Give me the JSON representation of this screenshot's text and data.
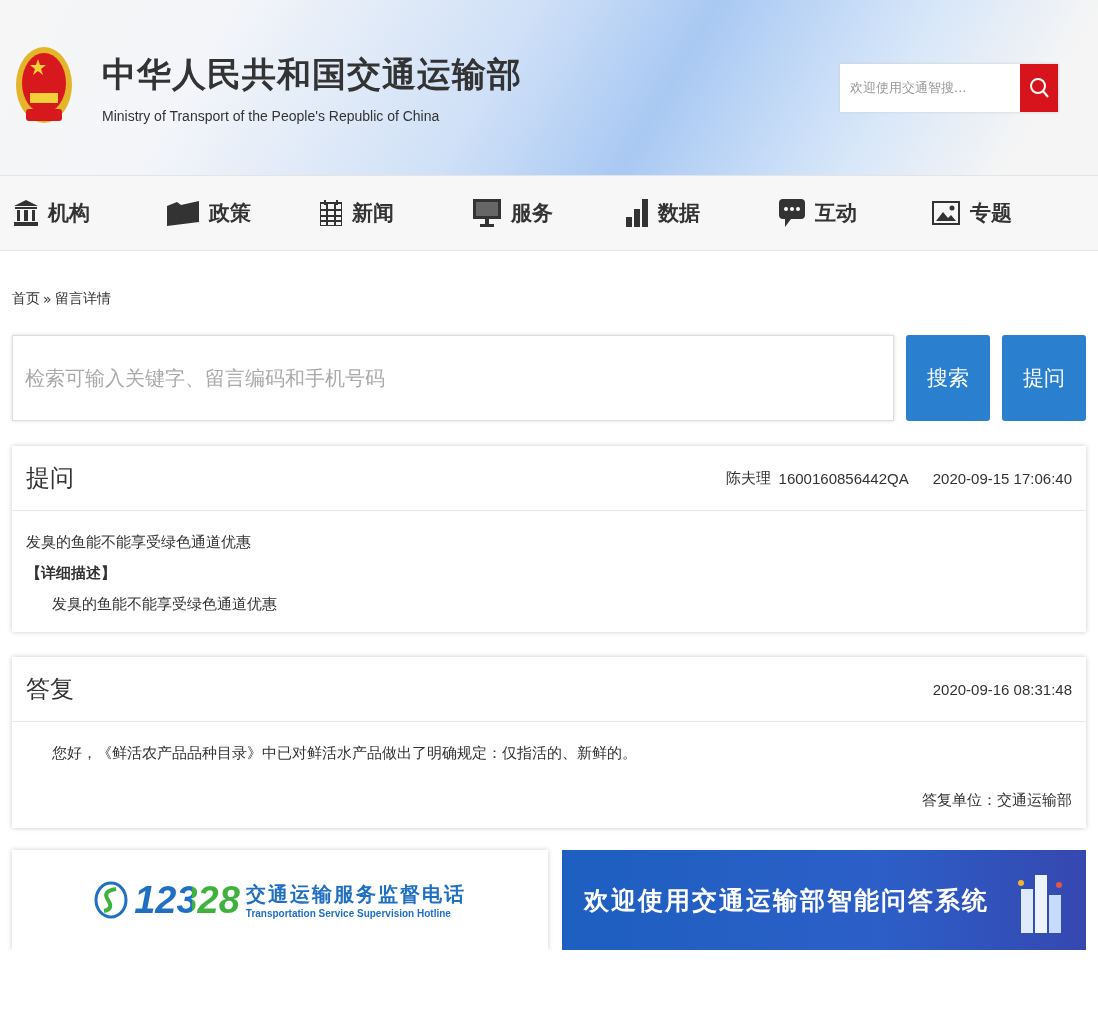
{
  "header": {
    "title": "中华人民共和国交通运输部",
    "subtitle": "Ministry of Transport of the People's Republic of China",
    "search": {
      "placeholder": "欢迎使用交通智搜..."
    }
  },
  "nav": [
    {
      "label": "机构"
    },
    {
      "label": "政策"
    },
    {
      "label": "新闻"
    },
    {
      "label": "服务"
    },
    {
      "label": "数据"
    },
    {
      "label": "互动"
    },
    {
      "label": "专题"
    }
  ],
  "breadcrumb": {
    "home": "首页",
    "separator": "»",
    "current": "留言详情"
  },
  "search": {
    "placeholder": "检索可输入关键字、留言编码和手机号码",
    "buttons": [
      "搜索",
      "提问"
    ]
  },
  "question": {
    "title": "提问",
    "author": "陈夫理",
    "code": "1600160856442QA",
    "time": "2020-09-15 17:06:40",
    "subject": "发臭的鱼能不能享受绿色通道优惠",
    "detail_label": "【详细描述】",
    "detail": "发臭的鱼能不能享受绿色通道优惠"
  },
  "answer": {
    "title": "答复",
    "time": "2020-09-16 08:31:48",
    "text": "您好，《鲜活农产品品种目录》中已对鲜活水产品做出了明确规定：仅指活的、新鲜的。",
    "unit": "答复单位：交通运输部"
  },
  "banners": {
    "hotline": {
      "number": "12328",
      "title": "交通运输服务监督电话",
      "subtitle": "Transportation Service Supervision Hotline"
    },
    "assistant": {
      "title": "欢迎使用交通运输部智能问答系统"
    }
  }
}
